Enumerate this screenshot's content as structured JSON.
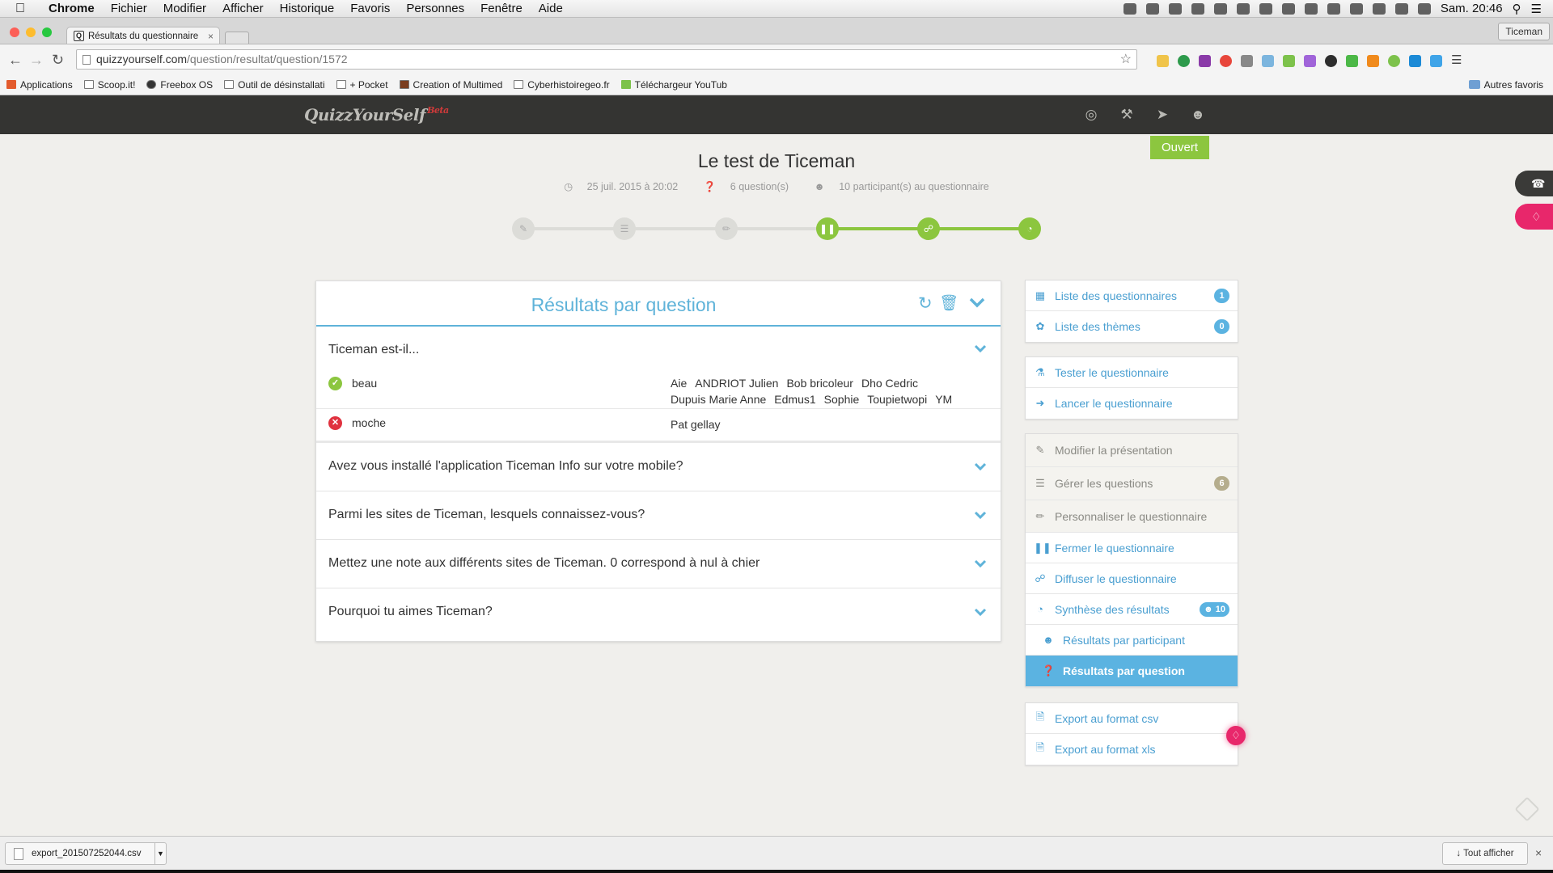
{
  "menubar": {
    "app": "Chrome",
    "items": [
      "Fichier",
      "Modifier",
      "Afficher",
      "Historique",
      "Favoris",
      "Personnes",
      "Fenêtre",
      "Aide"
    ],
    "clock": "Sam. 20:46"
  },
  "browser": {
    "tab_title": "Résultats du questionnaire",
    "profile": "Ticeman",
    "url_host": "quizzyourself.com",
    "url_path": "/question/resultat/question/1572",
    "bookmarks": [
      "Applications",
      "Scoop.it!",
      "Freebox OS",
      "Outil de désinstallati",
      "+ Pocket",
      "Creation of Multimed",
      "Cyberhistoiregeo.fr",
      "Téléchargeur YouTub"
    ],
    "other_bookmarks": "Autres favoris"
  },
  "site": {
    "logo": "QuizzYourSelf",
    "logo_beta": "Beta"
  },
  "quiz": {
    "status": "Ouvert",
    "title": "Le test de Ticeman",
    "date": "25 juil. 2015 à 20:02",
    "questions_count": "6 question(s)",
    "participants": "10 participant(s) au questionnaire"
  },
  "panel": {
    "title": "Résultats par question",
    "questions": [
      {
        "text": "Ticeman est-il...",
        "expanded": true
      },
      {
        "text": "Avez vous installé l'application Ticeman Info sur votre mobile?"
      },
      {
        "text": "Parmi les sites de Ticeman, lesquels connaissez-vous?"
      },
      {
        "text": "Mettez une note aux différents sites de Ticeman. 0 correspond à nul à chier"
      },
      {
        "text": "Pourquoi tu aimes Ticeman?"
      }
    ],
    "answers": [
      {
        "label": "beau",
        "correct": true,
        "names": [
          "Aie",
          "ANDRIOT Julien",
          "Bob bricoleur",
          "Dho Cedric",
          "Dupuis Marie Anne",
          "Edmus1",
          "Sophie",
          "Toupietwopi",
          "YM"
        ]
      },
      {
        "label": "moche",
        "correct": false,
        "names": [
          "Pat gellay"
        ]
      }
    ]
  },
  "sidebar": {
    "group1": [
      {
        "label": "Liste des questionnaires",
        "count": "1"
      },
      {
        "label": "Liste des thèmes",
        "count": "0"
      }
    ],
    "group2": [
      {
        "label": "Tester le questionnaire"
      },
      {
        "label": "Lancer le questionnaire"
      }
    ],
    "group3": [
      {
        "label": "Modifier la présentation"
      },
      {
        "label": "Gérer les questions",
        "count": "6"
      },
      {
        "label": "Personnaliser le questionnaire"
      },
      {
        "label": "Fermer le questionnaire"
      },
      {
        "label": "Diffuser le questionnaire"
      },
      {
        "label": "Synthèse des résultats",
        "count": "10"
      },
      {
        "label": "Résultats par participant"
      },
      {
        "label": "Résultats par question"
      }
    ],
    "group4": [
      {
        "label": "Export au format csv"
      },
      {
        "label": "Export au format xls"
      }
    ]
  },
  "downloads": {
    "file": "export_201507252044.csv",
    "show_all": "Tout afficher"
  },
  "colors": {
    "accent": "#5fb3d9",
    "green": "#8cc63f",
    "header": "#343432",
    "pink": "#e8276b"
  }
}
